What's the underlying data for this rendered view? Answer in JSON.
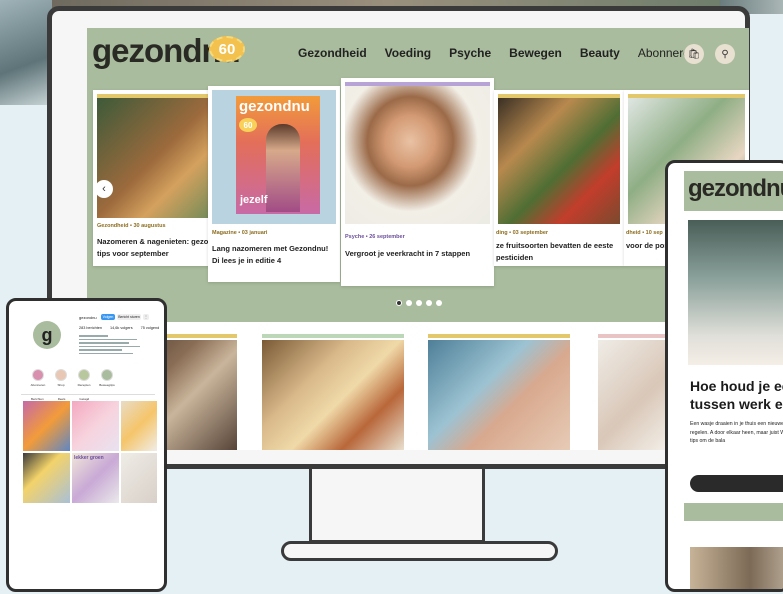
{
  "site": {
    "logo": "gezondnu",
    "anniversary": "60",
    "nav": [
      "Gezondheid",
      "Voeding",
      "Psyche",
      "Bewegen",
      "Beauty"
    ],
    "nav_subscribe": "Abonneren",
    "icons": {
      "cart": "bag-icon",
      "search": "search-icon"
    }
  },
  "carousel": {
    "cards": [
      {
        "meta": "Gezondheid • 30 augustus",
        "title": "Nazomeren & nagenieten: gezon tips voor september",
        "bar": "#e2c86a",
        "meta_color": "#8c6d1f"
      },
      {
        "meta": "Magazine • 03 januari",
        "title": "Lang nazomeren met Gezondnu! Di lees je in editie 4",
        "bar": "#e2c86a",
        "meta_color": "#8c6d1f"
      },
      {
        "meta": "Psyche • 26 september",
        "title": "Vergroot je veerkracht in 7 stappen",
        "bar": "#b8a3d6",
        "meta_color": "#6b4f9a"
      },
      {
        "meta": "ding • 03 september",
        "title": "ze fruitsoorten bevatten de eeste pesticiden",
        "bar": "#e2c86a",
        "meta_color": "#8c6d1f"
      },
      {
        "meta": "dheid • 10 sep",
        "title": "voor de por isel verspil",
        "bar": "#e2c86a",
        "meta_color": "#8c6d1f"
      }
    ],
    "magazine_cover": {
      "title": "gezondnu",
      "badge": "60",
      "cover_line": "jezelf"
    },
    "dots": 5,
    "active_dot": 0
  },
  "lower_cards_bars": [
    "#e2c86a",
    "#bcd6b8",
    "#e2c86a",
    "#e8c4c4"
  ],
  "phone": {
    "avatar_letter": "g",
    "username": "gezondnu",
    "buttons": [
      "Volgen",
      "Bericht sturen"
    ],
    "stats": [
      "283 berichten",
      "14,6k volgers",
      "75 volgend"
    ],
    "highlights": [
      "Abonneren",
      "Shop",
      "Recepten",
      "Beweegtips"
    ],
    "tabs": [
      "Berichten",
      "Reels",
      "Getagd"
    ],
    "grid_overlay_text": "lekker groen"
  },
  "tablet": {
    "logo": "gezondnu",
    "headline": "Hoe houd je ee tussen werk en",
    "body": "Een wasje draaien in je thuis een nieuwe oppas regelen. A door elkaar heen, maar juist Wij geven je tips om de bala"
  }
}
